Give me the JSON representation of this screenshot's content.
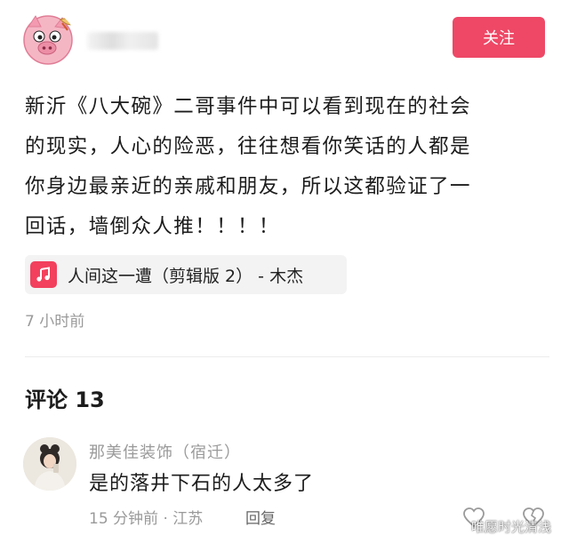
{
  "header": {
    "follow_label": "关注",
    "avatar_icon": "pig-avatar-icon"
  },
  "post": {
    "lines": [
      "新沂《八大碗》二哥事件中可以看到现在的社会",
      "的现实，人心的险恶，往往想看你笑话的人都是",
      "你身边最亲近的亲戚和朋友，所以这都验证了一",
      "回话，墙倒众人推！！！！"
    ],
    "music": {
      "icon": "music-note-icon",
      "label": "人间这一遭（剪辑版 2） - 木杰",
      "accent": "#f2405d"
    },
    "time_ago": "7 小时前"
  },
  "comments": {
    "header": "评论 13",
    "items": [
      {
        "user": "那美佳装饰（宿迁）",
        "text": "是的落井下石的人太多了",
        "meta": "15 分钟前 · 江苏",
        "reply_label": "回复"
      }
    ]
  },
  "watermark": "唯愿时光清浅",
  "colors": {
    "follow_button": "#ee4866",
    "music_icon": "#f2405d"
  }
}
